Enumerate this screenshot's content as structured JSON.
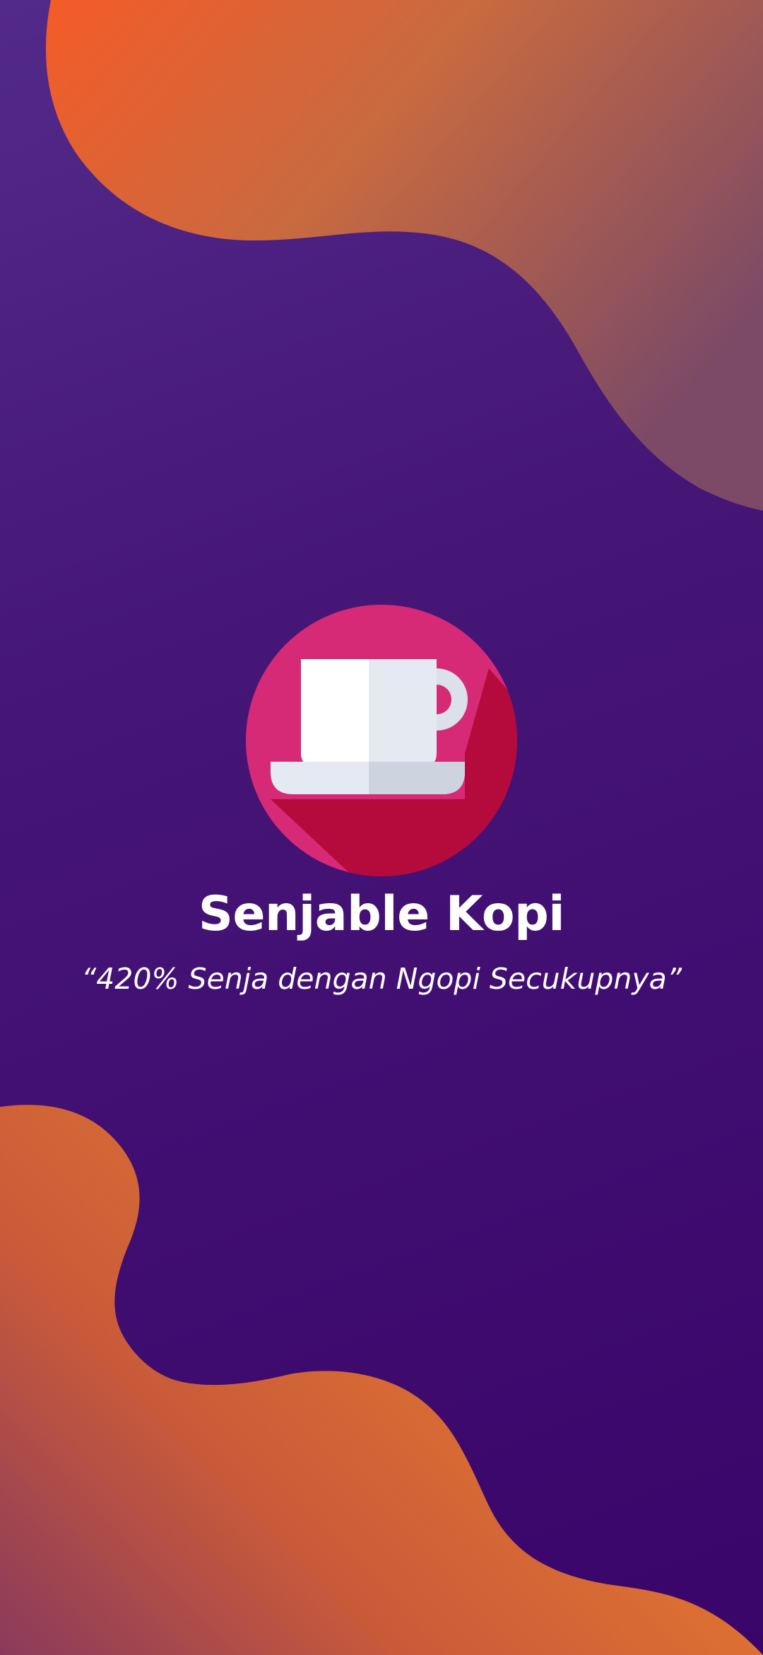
{
  "splash": {
    "app_name": "Senjable Kopi",
    "tagline": "“420% Senja dengan Ngopi Secukupnya”",
    "logo_icon": "coffee-cup-icon"
  },
  "colors": {
    "background": "#3f0c70",
    "blob_orange": "#f45b28",
    "blob_brown": "#875068",
    "logo_circle": "#d62a76",
    "logo_shadow": "#b40a3c",
    "cup_light": "#ffffff",
    "cup_shade": "#e5e9f2",
    "cup_dark": "#cdd3df"
  }
}
